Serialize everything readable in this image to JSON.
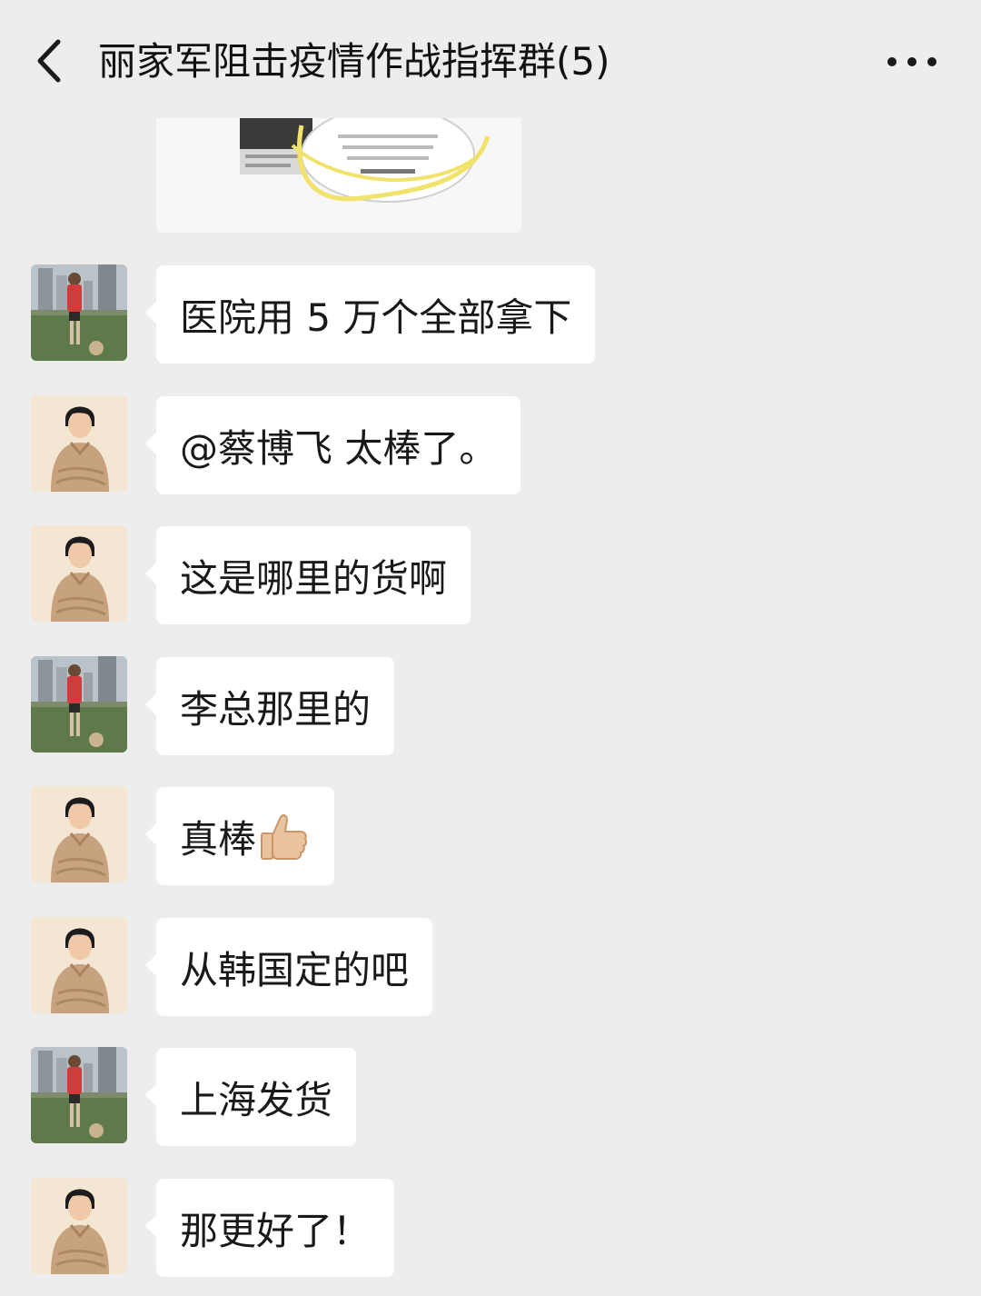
{
  "header": {
    "title": "丽家军阻击疫情作战指挥群(5)",
    "back_icon": "chevron-left-icon",
    "more_icon": "more-dots-icon"
  },
  "messages": [
    {
      "sender": "cai",
      "text": "医院用 5 万个全部拿下"
    },
    {
      "sender": "lady",
      "text": "@蔡博飞  太棒了。"
    },
    {
      "sender": "lady",
      "text": "这是哪里的货啊"
    },
    {
      "sender": "cai",
      "text": "李总那里的"
    },
    {
      "sender": "lady",
      "text": "真棒",
      "emoji": "thumbs-up-icon"
    },
    {
      "sender": "lady",
      "text": "从韩国定的吧"
    },
    {
      "sender": "cai",
      "text": "上海发货"
    },
    {
      "sender": "lady",
      "text": "那更好了！"
    }
  ],
  "colors": {
    "background": "#ededed",
    "bubble": "#ffffff",
    "text": "#191919"
  }
}
